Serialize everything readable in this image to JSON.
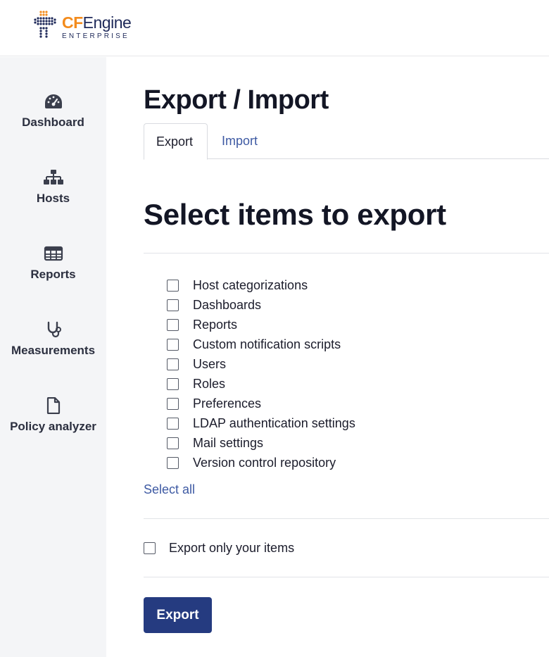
{
  "brand": {
    "name_prefix": "CF",
    "name_suffix": "Engine",
    "subtitle": "ENTERPRISE",
    "accent_color": "#f38b1c",
    "primary_color": "#1f2a5a"
  },
  "sidebar": {
    "items": [
      {
        "label": "Dashboard",
        "icon": "speedometer-icon"
      },
      {
        "label": "Hosts",
        "icon": "sitemap-icon"
      },
      {
        "label": "Reports",
        "icon": "table-icon"
      },
      {
        "label": "Measurements",
        "icon": "stethoscope-icon"
      },
      {
        "label": "Policy analyzer",
        "icon": "file-icon"
      }
    ]
  },
  "page": {
    "title": "Export / Import",
    "tabs": [
      {
        "label": "Export",
        "active": true
      },
      {
        "label": "Import",
        "active": false
      }
    ]
  },
  "export": {
    "section_title": "Select items to export",
    "items": [
      {
        "label": "Host categorizations",
        "checked": false
      },
      {
        "label": "Dashboards",
        "checked": false
      },
      {
        "label": "Reports",
        "checked": false
      },
      {
        "label": "Custom notification scripts",
        "checked": false
      },
      {
        "label": "Users",
        "checked": false
      },
      {
        "label": "Roles",
        "checked": false
      },
      {
        "label": "Preferences",
        "checked": false
      },
      {
        "label": "LDAP authentication settings",
        "checked": false
      },
      {
        "label": "Mail settings",
        "checked": false
      },
      {
        "label": "Version control repository",
        "checked": false
      }
    ],
    "select_all_label": "Select all",
    "only_yours_label": "Export only your items",
    "only_yours_checked": false,
    "button_label": "Export",
    "button_color": "#253b80"
  }
}
